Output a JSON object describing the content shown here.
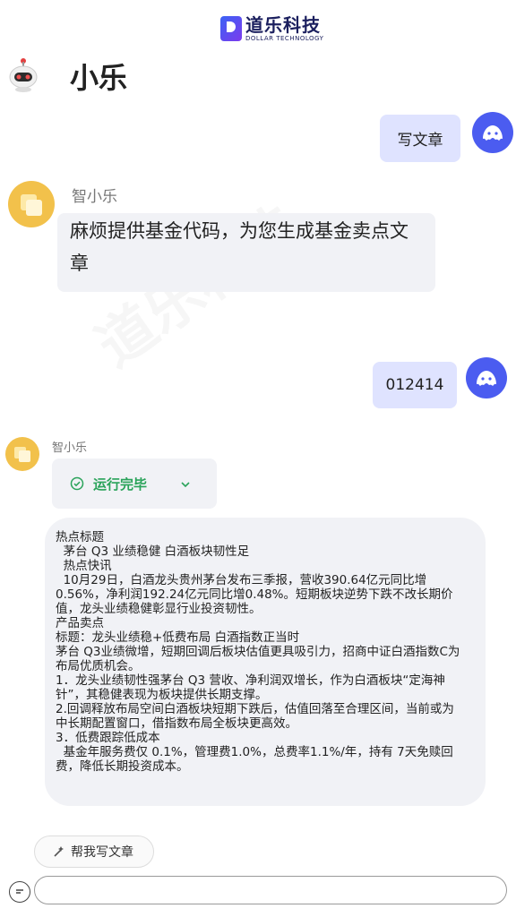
{
  "brand": {
    "name_cn": "道乐科技",
    "name_en": "DOLLAR TECHNOLOGY",
    "icon": "brand-logo-icon"
  },
  "bot": {
    "title": "小乐",
    "name": "智小乐",
    "avatar_icon": "bot-avatar-icon"
  },
  "watermark": "道乐科技",
  "messages": {
    "user_1": "写文章",
    "bot_1": "麻烦提供基金代码，为您生成基金卖点文章",
    "user_2": "012414",
    "bot_2_status": "运行完毕"
  },
  "article": {
    "lines": [
      "热点标题",
      "  茅台 Q3 业绩稳健 白酒板块韧性足",
      "  热点快讯",
      "  10月29日，白酒龙头贵州茅台发布三季报，营收390.64亿元同比增",
      "0.56%，净利润192.24亿元同比增0.48%。短期板块逆势下跌不改长期价",
      "值，龙头业绩稳健彰显行业投资韧性。",
      "产品卖点",
      "标题：龙头业绩稳+低费布局 白酒指数正当时",
      "茅台 Q3业绩微增，短期回调后板块估值更具吸引力，招商中证白酒指数C为",
      "布局优质机会。",
      "1．龙头业绩韧性强茅台 Q3 营收、净利润双增长，作为白酒板块“定海神",
      "针”，其稳健表现为板块提供长期支撑。",
      "2.回调释放布局空间白酒板块短期下跌后，估值回落至合理区间，当前或为",
      "中长期配置窗口，借指数布局全板块更高效。",
      "3．低费跟踪低成本",
      "  基金年服务费仅 0.1%，管理费1.0%，总费率1.1%/年，持有 7天免赎回",
      "费，降低长期投资成本。"
    ]
  },
  "suggestion": {
    "label": "帮我写文章",
    "icon": "sparkle-icon"
  },
  "input": {
    "value": "",
    "placeholder": "",
    "icon": "chat-toggle-icon"
  },
  "colors": {
    "user_bubble": "#dfe3ff",
    "bot_bubble": "#f1f2f6",
    "accent": "#4b5cf0",
    "success": "#2aa35a"
  }
}
